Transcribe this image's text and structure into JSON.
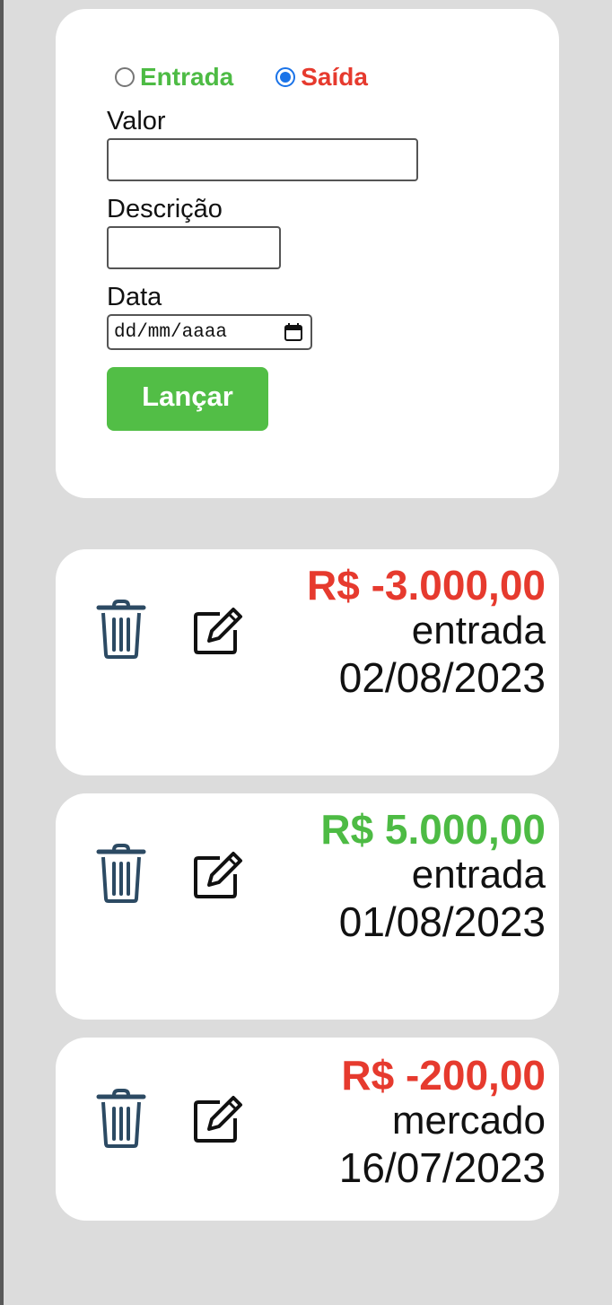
{
  "form": {
    "type_in_label": "Entrada",
    "type_out_label": "Saída",
    "selected_type": "Saída",
    "value_label": "Valor",
    "value_input": "",
    "description_label": "Descrição",
    "description_input": "",
    "date_label": "Data",
    "date_placeholder": "dd/mm/aaaa",
    "submit_label": "Lançar"
  },
  "transactions": [
    {
      "amount": "R$ -3.000,00",
      "description": "entrada",
      "date": "02/08/2023",
      "sign": "negative"
    },
    {
      "amount": "R$ 5.000,00",
      "description": "entrada",
      "date": "01/08/2023",
      "sign": "positive"
    },
    {
      "amount": "R$ -200,00",
      "description": "mercado",
      "date": "16/07/2023",
      "sign": "negative"
    }
  ],
  "icons": {
    "delete": "trash-icon",
    "edit": "edit-icon",
    "calendar": "calendar-icon"
  },
  "colors": {
    "background": "#dcdcdc",
    "card": "#ffffff",
    "positive": "#4dbb44",
    "negative": "#e63a2e",
    "button": "#52be46",
    "radio_checked": "#1a73e8",
    "trash_icon": "#2c4a63"
  }
}
